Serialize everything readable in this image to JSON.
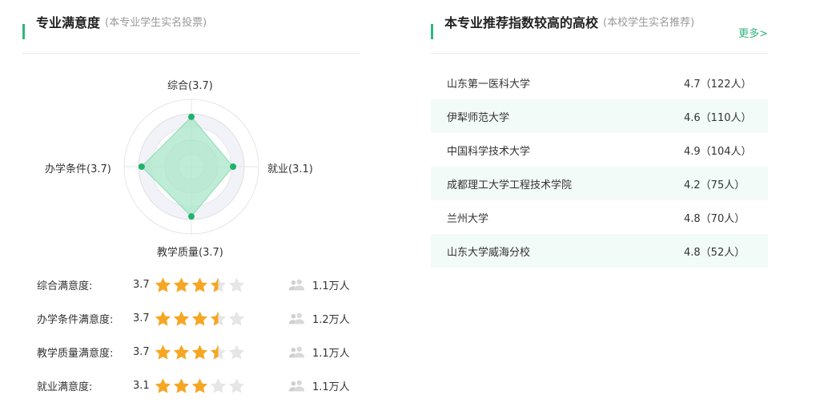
{
  "satisfaction": {
    "title": "专业满意度",
    "subtitle": "(本专业学生实名投票)",
    "radar": {
      "top": {
        "label": "综合(3.7)",
        "value": 3.7
      },
      "right": {
        "label": "就业(3.1)",
        "value": 3.1
      },
      "bottom": {
        "label": "教学质量(3.7)",
        "value": 3.7
      },
      "left": {
        "label": "办学条件(3.7)",
        "value": 3.7
      }
    },
    "rows": [
      {
        "label": "综合满意度:",
        "score": "3.7",
        "rating": 3.7,
        "count": "1.1万人"
      },
      {
        "label": "办学条件满意度:",
        "score": "3.7",
        "rating": 3.7,
        "count": "1.2万人"
      },
      {
        "label": "教学质量满意度:",
        "score": "3.7",
        "rating": 3.7,
        "count": "1.1万人"
      },
      {
        "label": "就业满意度:",
        "score": "3.1",
        "rating": 3.1,
        "count": "1.1万人"
      }
    ]
  },
  "recommend": {
    "title": "本专业推荐指数较高的高校",
    "subtitle": "(本校学生实名推荐)",
    "more": "更多>",
    "schools": [
      {
        "name": "山东第一医科大学",
        "score": "4.7（122人）"
      },
      {
        "name": "伊犁师范大学",
        "score": "4.6（110人）"
      },
      {
        "name": "中国科学技术大学",
        "score": "4.9（104人）"
      },
      {
        "name": "成都理工大学工程技术学院",
        "score": "4.2（75人）"
      },
      {
        "name": "兰州大学",
        "score": "4.8（70人）"
      },
      {
        "name": "山东大学威海分校",
        "score": "4.8（52人）"
      }
    ]
  },
  "colors": {
    "accent": "#2fb67c",
    "star": "#f5a623",
    "star_empty": "#e6e6e6",
    "radar_fill": "#a8e6c8",
    "row_alt": "#f2fbf8"
  }
}
